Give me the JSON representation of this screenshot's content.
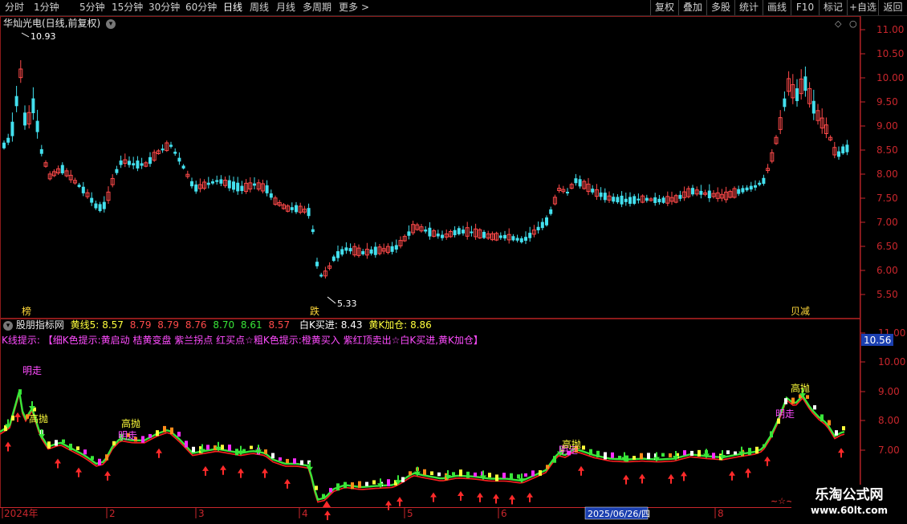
{
  "toolbar": {
    "periods": [
      "分时",
      "1分钟",
      "5分钟",
      "15分钟",
      "30分钟",
      "60分钟",
      "日线",
      "周线",
      "月线",
      "多周期",
      "更多"
    ],
    "active_period": "日线",
    "more_arrow": ">",
    "right_buttons": [
      "复权",
      "叠加",
      "多股",
      "统计",
      "画线",
      "F10",
      "标记",
      "+自选",
      "返回"
    ]
  },
  "stock": {
    "title": "华灿光电(日线,前复权)",
    "high_label": "10.93",
    "low_label": "5.33",
    "price_ticks": [
      "11.00",
      "10.50",
      "10.00",
      "9.50",
      "9.00",
      "8.50",
      "8.00",
      "7.50",
      "7.00",
      "6.50",
      "6.00",
      "5.50"
    ],
    "event_labels": [
      "榜",
      "跌",
      "贝减"
    ]
  },
  "indicator": {
    "name": "股朋指标网",
    "yellow_label": "黄线5:",
    "yellow_value": "8.57",
    "extra_values": [
      "8.79",
      "8.79",
      "8.76",
      "8.70",
      "8.61",
      "8.57"
    ],
    "white_k_label": "白K买进:",
    "white_k_value": "8.43",
    "yellow_k_label": "黄K加仓:",
    "yellow_k_value": "8.86",
    "hint_prefix": "K线提示:",
    "hint_text": "【细K色提示:黄启动 桔黄变盘 紫兰拐点 红买点☆粗K色提示:橙黄买入 紫红顶卖出☆白K买进,黄K加仓】",
    "ticks": [
      "11.00",
      "10.00",
      "9.00",
      "8.00",
      "7.00"
    ],
    "current_badge": "10.56",
    "annotations": [
      "明走",
      "高抛",
      "高抛",
      "明走",
      "明走",
      "高抛",
      "高抛",
      "明走"
    ],
    "marker": "~☆~之"
  },
  "xaxis": {
    "labels": [
      "2024年",
      "2",
      "3",
      "4",
      "5",
      "6",
      "7",
      "8"
    ],
    "cursor_date": "2025/06/26/四"
  },
  "watermark": {
    "name": "乐淘公式网",
    "url": "www.60lt.com"
  },
  "colors": {
    "up": "#ff4a4a",
    "down": "#43e0ee",
    "axis": "#c8262c",
    "green_line": "#39e639",
    "red_line": "#ff2020",
    "yellow": "#ffff3c",
    "magenta": "#ff2cff"
  }
}
